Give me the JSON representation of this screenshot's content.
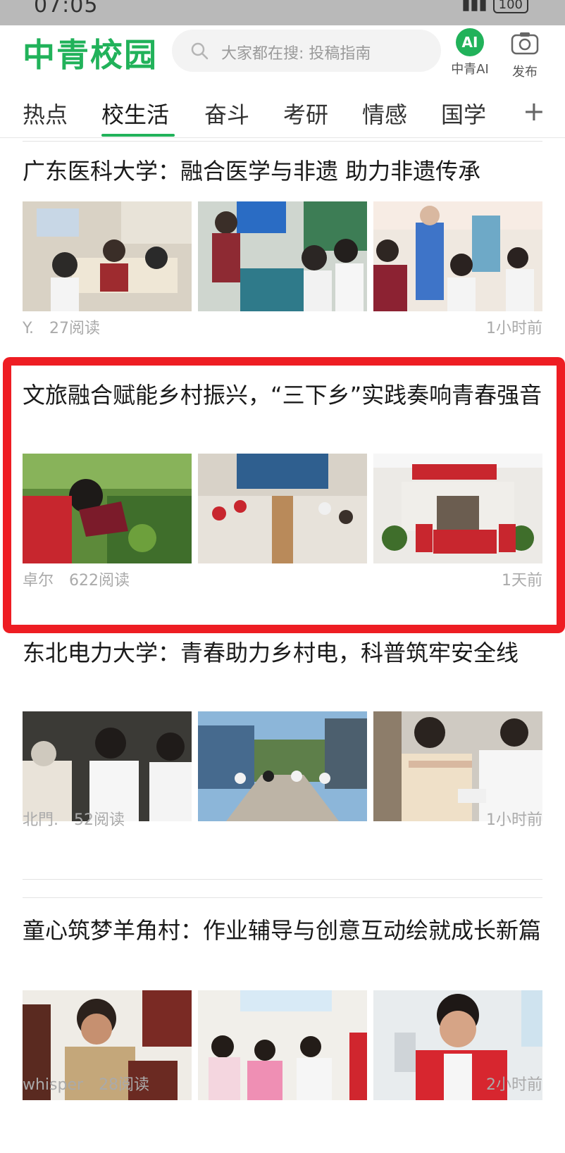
{
  "status": {
    "time": "07:05",
    "battery": "100"
  },
  "header": {
    "logo": "中青校园",
    "search_placeholder": "大家都在搜: 投稿指南",
    "ai_badge": "AI",
    "ai_label": "中青AI",
    "publish_label": "发布"
  },
  "tabs": [
    "热点",
    "校生活",
    "奋斗",
    "考研",
    "情感",
    "国学"
  ],
  "tab_add": "+",
  "articles": [
    {
      "title": "广东医科大学：融合医学与非遗 助力非遗传承",
      "author": "Y.",
      "reads": "27阅读",
      "time": "1小时前"
    },
    {
      "title": "文旅融合赋能乡村振兴，“三下乡”实践奏响青春强音",
      "author": "卓尔",
      "reads": "622阅读",
      "time": "1天前"
    },
    {
      "title": "东北电力大学：青春助力乡村电，科普筑牢安全线",
      "author": "北門.",
      "reads": "52阅读",
      "time": "1小时前"
    },
    {
      "title": "童心筑梦羊角村：作业辅导与创意互动绘就成长新篇",
      "author": "whisper",
      "reads": "28阅读",
      "time": "2小时前"
    }
  ],
  "colors": {
    "brand": "#21b25a",
    "highlight": "#ee1d23",
    "meta": "#aaaaaa"
  }
}
